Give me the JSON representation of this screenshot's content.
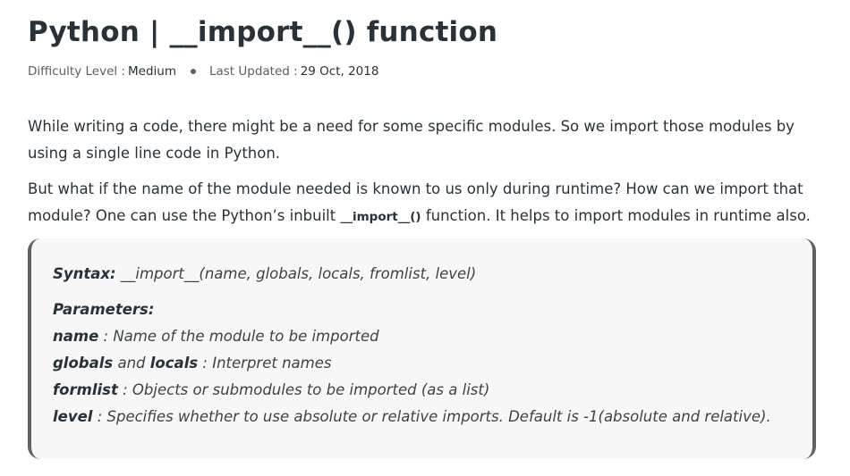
{
  "article": {
    "title": "Python | __import__() function",
    "difficulty_label": "Difficulty Level :",
    "difficulty_value": "Medium",
    "updated_label": "Last Updated :",
    "updated_value": "29 Oct, 2018"
  },
  "paragraphs": {
    "p1": "While writing a code, there might be a need for some specific modules. So we import those modules by using a single line code in Python.",
    "p2_before": "But what if the name of the module needed is known to us only during runtime? How can we import that module? One can use the Python’s inbuilt ",
    "p2_code": "__import__()",
    "p2_after": " function. It helps to import modules in runtime also."
  },
  "syntax": {
    "label": "Syntax:",
    "signature": " __import__(name, globals, locals, fromlist, level)",
    "params_label": "Parameters:",
    "params": {
      "name_term": "name",
      "name_desc": " : Name of the module to be imported",
      "globals_term": "globals",
      "and_word": " and ",
      "locals_term": "locals",
      "globals_desc": " : Interpret names",
      "fromlist_term": "formlist",
      "fromlist_desc": " : Objects or submodules to be imported (as a list)",
      "level_term": "level",
      "level_desc": " : Specifies whether to use absolute or relative imports. Default is -1(absolute and relative)."
    }
  }
}
